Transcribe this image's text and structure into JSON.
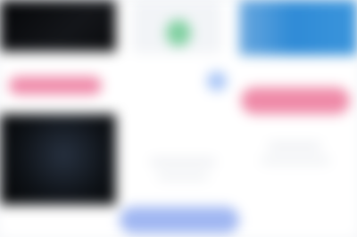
{
  "colors": {
    "page_background": "#f7f8fa",
    "accent_pink": "#ef88a8",
    "accent_blue": "#a0b7f2",
    "hero_blue": "#2f8bd6",
    "accent_green": "#7fd0a0",
    "dark_media": "#0a0b0d"
  },
  "left_panel": {
    "top_media": "dark-image-thumbnail",
    "action_bar": "pink-action-bar",
    "bottom_media": "dark-image-thumbnail"
  },
  "center_panel": {
    "tile_icon": "green-app-icon",
    "status_dot": "blue-status-dot",
    "primary_button": "blue-primary-button"
  },
  "right_panel": {
    "hero_media": "blue-banner-image",
    "action_bar": "pink-action-button"
  }
}
